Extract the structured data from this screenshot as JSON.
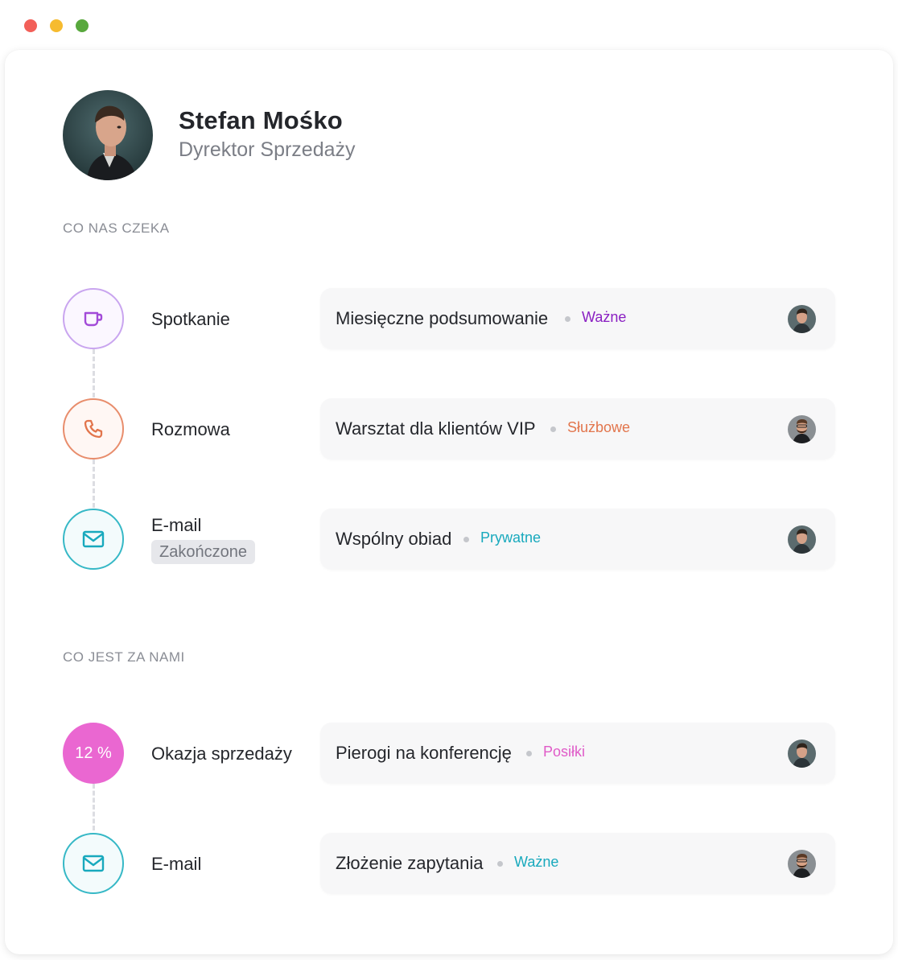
{
  "window": {
    "controls": [
      "close",
      "minimize",
      "maximize"
    ]
  },
  "profile": {
    "name": "Stefan Mośko",
    "role": "Dyrektor Sprzedaży",
    "avatar": "portrait-photo"
  },
  "sections": {
    "upcoming_label": "CO NAS CZEKA",
    "past_label": "CO JEST ZA NAMI"
  },
  "upcoming": [
    {
      "icon": "cup-icon",
      "type": "Spotkanie",
      "event": "Miesięczne podsumowanie",
      "tag": "Ważne",
      "tag_color": "#8a1fc2",
      "assignee": "man-avatar"
    },
    {
      "icon": "phone-icon",
      "type": "Rozmowa",
      "event": "Warsztat dla klientów VIP",
      "tag": "Służbowe",
      "tag_color": "#e2754c",
      "assignee": "bearded-man-avatar"
    },
    {
      "icon": "mail-icon",
      "type": "E-mail",
      "status": "Zakończone",
      "event": "Wspólny obiad",
      "tag": "Prywatne",
      "tag_color": "#18a9bd",
      "assignee": "man-avatar"
    }
  ],
  "past": [
    {
      "badge": "12 %",
      "type": "Okazja sprzedaży",
      "event": "Pierogi na konferencję",
      "tag": "Posiłki",
      "tag_color": "#e05bc8",
      "assignee": "man-avatar"
    },
    {
      "icon": "mail-icon",
      "type": "E-mail",
      "event": "Złożenie zapytania",
      "tag": "Ważne",
      "tag_color": "#18a9bd",
      "assignee": "bearded-man-avatar"
    }
  ]
}
